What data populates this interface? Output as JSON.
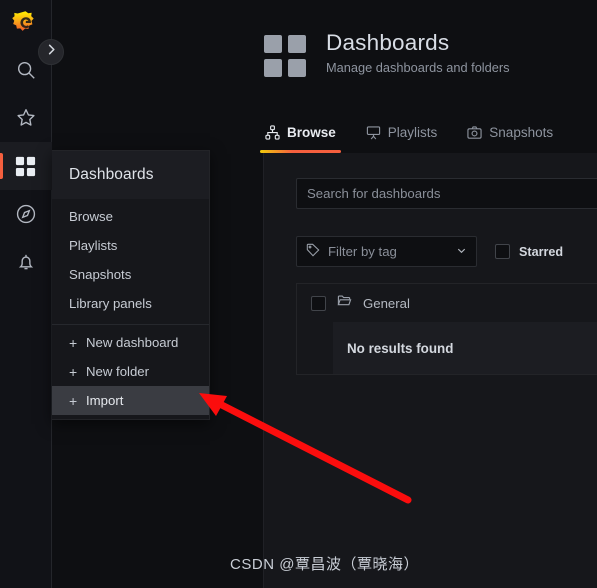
{
  "brand": {
    "logo_icon": "grafana-logo",
    "accent_color": "#f55f3e"
  },
  "nav_rail": {
    "expand_button_icon": "chevron-right-icon",
    "items": [
      {
        "icon": "search-icon",
        "name": "search",
        "active": false
      },
      {
        "icon": "star-icon",
        "name": "starred",
        "active": false
      },
      {
        "icon": "dashboards-grid-icon",
        "name": "dashboards",
        "active": true
      },
      {
        "icon": "compass-icon",
        "name": "explore",
        "active": false
      },
      {
        "icon": "bell-icon",
        "name": "alerting",
        "active": false
      }
    ]
  },
  "dropdown": {
    "header": "Dashboards",
    "links": [
      {
        "label": "Browse"
      },
      {
        "label": "Playlists"
      },
      {
        "label": "Snapshots"
      },
      {
        "label": "Library panels"
      }
    ],
    "actions": [
      {
        "label": "New dashboard",
        "icon": "plus-icon",
        "highlighted": false
      },
      {
        "label": "New folder",
        "icon": "plus-icon",
        "highlighted": false
      },
      {
        "label": "Import",
        "icon": "plus-icon",
        "highlighted": true
      }
    ],
    "plus_glyph": "+"
  },
  "header": {
    "icon": "dashboards-grid-icon",
    "title": "Dashboards",
    "subtitle": "Manage dashboards and folders"
  },
  "tabs": [
    {
      "label": "Browse",
      "icon": "sitemap-icon",
      "active": true
    },
    {
      "label": "Playlists",
      "icon": "presentation-icon",
      "active": false
    },
    {
      "label": "Snapshots",
      "icon": "camera-icon",
      "active": false
    }
  ],
  "search": {
    "value": "",
    "placeholder": "Search for dashboards"
  },
  "filters": {
    "tag_filter_label": "Filter by tag",
    "tag_filter_icon": "tag-icon",
    "tag_filter_caret": "chevron-down-icon",
    "starred_label": "Starred",
    "starred_checked": false
  },
  "results": {
    "folder": {
      "name": "General",
      "icon": "folder-icon",
      "checked": false
    },
    "empty_message": "No results found"
  },
  "watermark": {
    "text": "CSDN @覃昌波（覃晓海）"
  },
  "annotation": {
    "color": "#fb0d0d",
    "points_to": "Import"
  }
}
